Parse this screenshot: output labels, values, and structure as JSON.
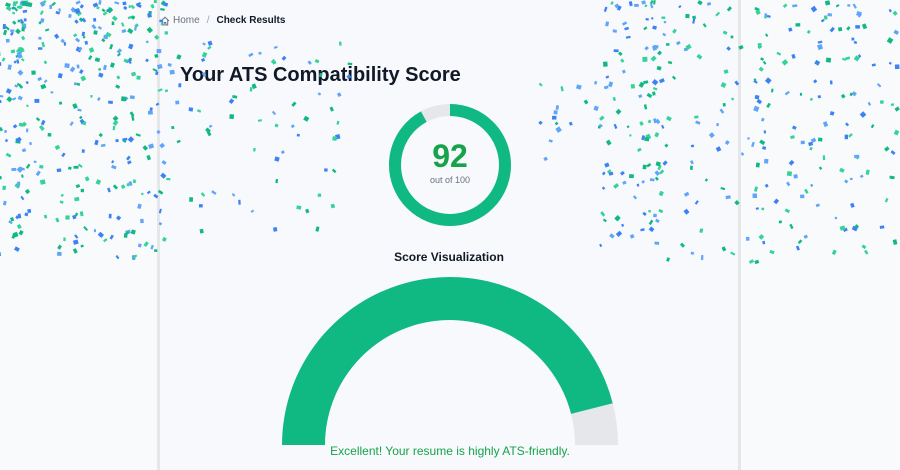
{
  "breadcrumb": {
    "home_label": "Home",
    "separator": "/",
    "current_label": "Check Results"
  },
  "page": {
    "title": "Your ATS Compatibility Score"
  },
  "score": {
    "value": "92",
    "max_label": "out of 100",
    "fraction": 0.92
  },
  "visualization": {
    "title": "Score Visualization",
    "status_text": "Excellent! Your resume is highly ATS-friendly."
  },
  "colors": {
    "accent_green": "#10b981",
    "score_text_green": "#16a34a",
    "track_gray": "#e5e7eb",
    "confetti_blue": "#3b82f6",
    "confetti_green": "#10b981"
  },
  "icons": {
    "home": "home-icon"
  }
}
